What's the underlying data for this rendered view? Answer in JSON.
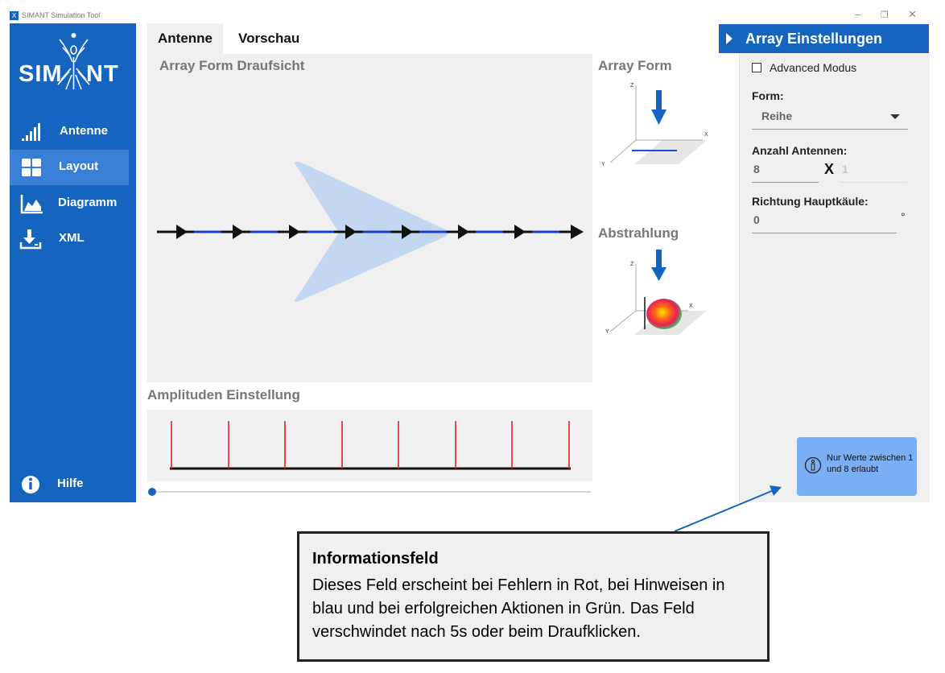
{
  "window": {
    "title": "SIMANT Simulation Tool",
    "icon_glyph": "X",
    "minimize": "–",
    "maximize": "❐",
    "close": "✕"
  },
  "colors": {
    "brand": "#1565C0",
    "active_nav": "#3a7fd6",
    "info_box": "#7aaef5",
    "panel_bg": "#f0f0f0"
  },
  "sidebar": {
    "logo": {
      "left": "SIM",
      "right": "NT"
    },
    "items": [
      {
        "label": "Antenne",
        "icon": "signal-bars-icon"
      },
      {
        "label": "Layout",
        "icon": "layout-grid-icon"
      },
      {
        "label": "Diagramm",
        "icon": "chart-area-icon"
      },
      {
        "label": "XML",
        "icon": "download-icon"
      }
    ],
    "help": {
      "label": "Hilfe",
      "icon": "info-icon"
    }
  },
  "tabs": [
    {
      "label": "Antenne",
      "active": true
    },
    {
      "label": "Vorschau",
      "active": false
    }
  ],
  "top_view": {
    "title": "Array Form Draufsicht",
    "element_count": 8
  },
  "array_form": {
    "title": "Array Form",
    "axes": {
      "z": "Z",
      "x": "X",
      "y": "Y"
    }
  },
  "abstrahlung": {
    "title": "Abstrahlung",
    "axes": {
      "z": "Z",
      "x": "X",
      "y": "Y"
    }
  },
  "amplitude": {
    "title": "Amplituden Einstellung",
    "bars": 8
  },
  "right_panel": {
    "title": "Array Einstellungen",
    "advanced_label": "Advanced Modus",
    "form_label": "Form:",
    "form_value": "Reihe",
    "count_label": "Anzahl Antennen:",
    "count_x": "8",
    "count_sep": "X",
    "count_y": "1",
    "direction_label": "Richtung Hauptkäule:",
    "direction_value": "0",
    "direction_unit": "°",
    "info_text": "Nur Werte zwischen 1 und 8 erlaubt"
  },
  "annotation": {
    "title": "Informationsfeld",
    "text": "Dieses Feld erscheint bei Fehlern in Rot, bei Hinweisen in blau und bei erfolgreichen Aktionen in Grün. Das Feld verschwindet nach 5s oder beim Draufklicken."
  }
}
